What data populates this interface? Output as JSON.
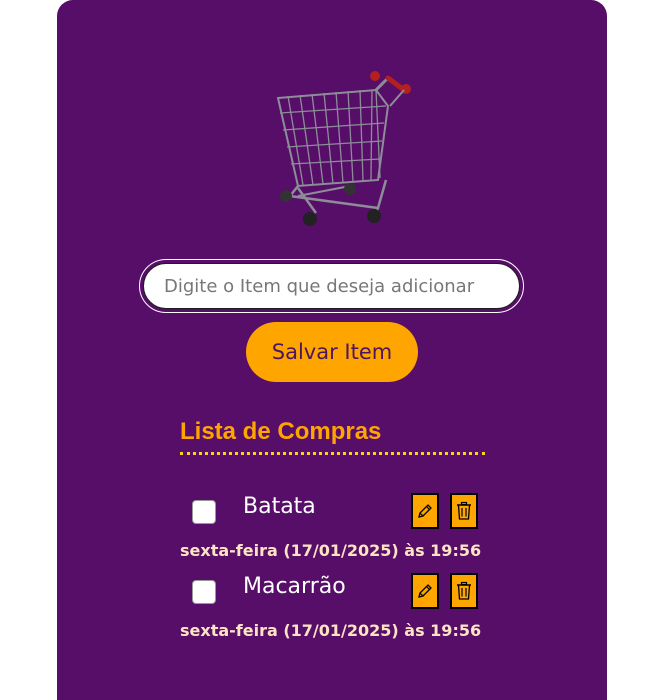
{
  "form": {
    "input_placeholder": "Digite o Item que deseja adicionar",
    "save_label": "Salvar Item"
  },
  "list": {
    "title": "Lista de Compras",
    "items": [
      {
        "name": "Batata",
        "date": "sexta-feira (17/01/2025) às 19:56",
        "checked": false
      },
      {
        "name": "Macarrão",
        "date": "sexta-feira (17/01/2025) às 19:56",
        "checked": false
      }
    ]
  },
  "icons": {
    "cart": "shopping-cart-icon",
    "edit": "pencil-icon",
    "delete": "trash-icon"
  },
  "colors": {
    "card_background": "#570e69",
    "accent": "#ffa500",
    "date_text": "#ffe4c4"
  }
}
